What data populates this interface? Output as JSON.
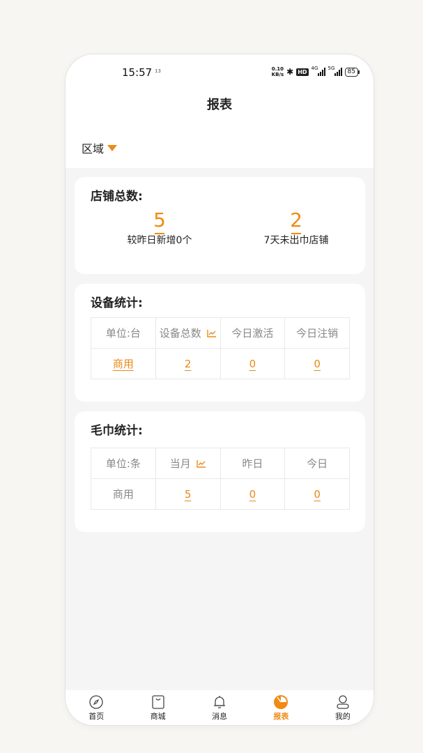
{
  "status_bar": {
    "time": "15:57",
    "time_superscript": "13",
    "net_speed": "0.10",
    "net_unit": "KB/s",
    "hd_badge": "HD",
    "signal_1": "4G",
    "signal_2": "5G",
    "battery": "85"
  },
  "header": {
    "title": "报表"
  },
  "filter": {
    "region_label": "区域"
  },
  "store_card": {
    "title": "店铺总数:",
    "stats": [
      {
        "value": "5",
        "label": "较昨日新增0个"
      },
      {
        "value": "2",
        "label": "7天未出巾店铺"
      }
    ]
  },
  "device_card": {
    "title": "设备统计:",
    "headers": [
      "单位:台",
      "设备总数",
      "今日激活",
      "今日注销"
    ],
    "row": [
      "商用",
      "2",
      "0",
      "0"
    ]
  },
  "towel_card": {
    "title": "毛巾统计:",
    "headers": [
      "单位:条",
      "当月",
      "昨日",
      "今日"
    ],
    "row": [
      "商用",
      "5",
      "0",
      "0"
    ]
  },
  "tabbar": {
    "items": [
      {
        "label": "首页",
        "icon": "compass-icon"
      },
      {
        "label": "商城",
        "icon": "shopping-bag-icon"
      },
      {
        "label": "消息",
        "icon": "bell-icon"
      },
      {
        "label": "报表",
        "icon": "pie-chart-icon",
        "active": true
      },
      {
        "label": "我的",
        "icon": "user-icon"
      }
    ]
  },
  "colors": {
    "accent": "#f08a12",
    "background": "#f5f5f5",
    "card": "#ffffff"
  }
}
